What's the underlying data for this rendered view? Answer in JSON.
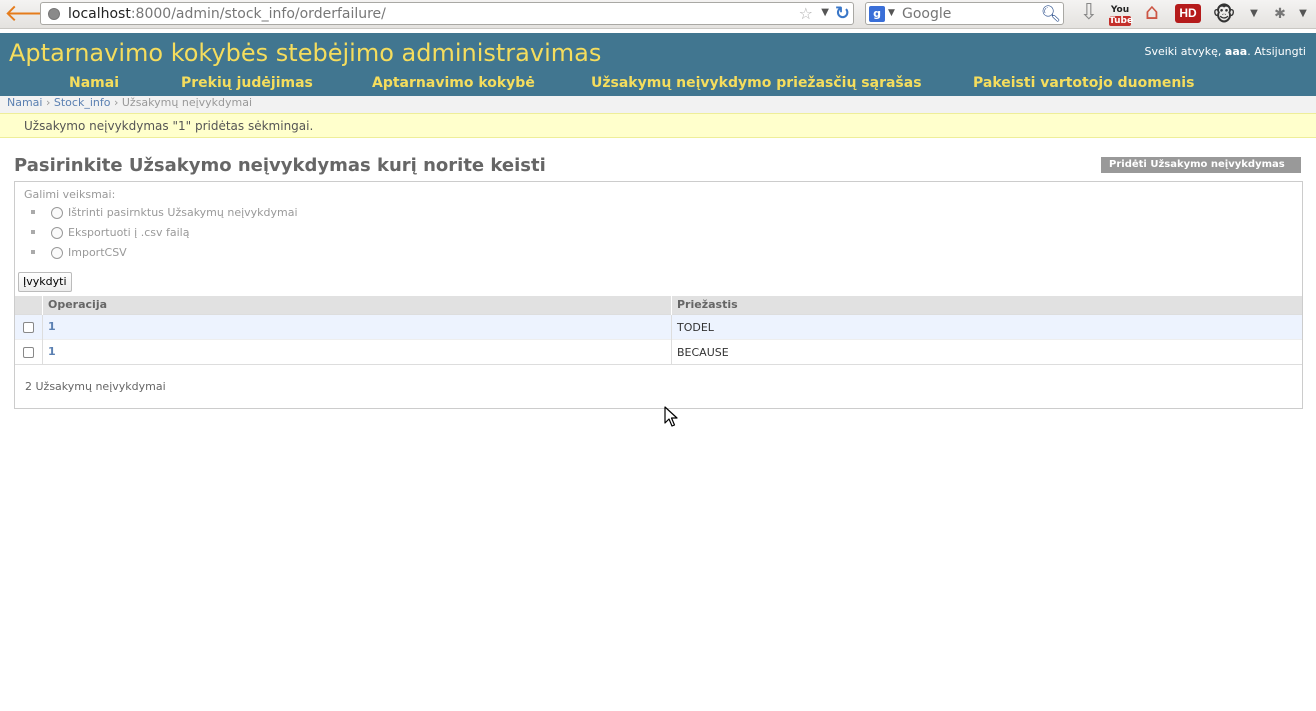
{
  "browser": {
    "url_host": "localhost",
    "url_path": ":8000/admin/stock_info/orderfailure/",
    "search_placeholder": "Google",
    "search_engine_label": "g",
    "youtube_label_top": "You",
    "youtube_label_bottom": "Tube",
    "hd_label": "HD"
  },
  "header": {
    "site_title": "Aptarnavimo kokybės stebėjimo administravimas",
    "user_greeting": "Sveiki atvykę,",
    "username": "aaa",
    "logout_label": "Atsijungti"
  },
  "nav": {
    "home": "Namai",
    "stock_movement": "Prekių judėjimas",
    "service_quality": "Aptarnavimo kokybė",
    "failure_reasons": "Užsakymų neįvykdymo priežasčių sąrašas",
    "change_user": "Pakeisti vartotojo duomenis"
  },
  "breadcrumbs": {
    "home": "Namai",
    "app": "Stock_info",
    "sep": "›",
    "current": "Užsakymų neįvykdymai"
  },
  "message": "Užsakymo neįvykdymas \"1\" pridėtas sėkmingai.",
  "content": {
    "title": "Pasirinkite Užsakymo neįvykdymas kurį norite keisti",
    "add_button": "Pridėti Užsakymo neįvykdymas",
    "actions_label": "Galimi veiksmai:",
    "actions": [
      "Ištrinti pasirnktus Užsakymų neįvykdymai",
      "Eksportuoti į .csv failą",
      "ImportCSV"
    ],
    "go_button": "Įvykdyti",
    "columns": {
      "operation": "Operacija",
      "reason": "Priežastis"
    },
    "rows": [
      {
        "operation": "1",
        "reason": "TODEL"
      },
      {
        "operation": "1",
        "reason": "BECAUSE"
      }
    ],
    "result_count": "2 Užsakymų neįvykdymai"
  }
}
